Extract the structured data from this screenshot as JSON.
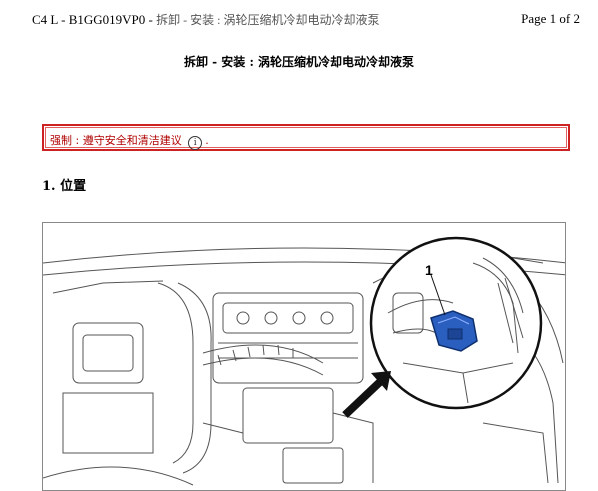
{
  "header": {
    "doc_code": "C4 L - B1GG019VP0 - ",
    "doc_title_short": "拆卸  - 安装  : 涡轮压缩机冷却电动冷却液泵",
    "page": "Page 1 of 2"
  },
  "document": {
    "title": "拆卸  - 安装  : 涡轮压缩机冷却电动冷却液泵"
  },
  "warning": {
    "label": "强制",
    "text": " : 遵守安全和清洁建议",
    "icon_glyph": "i",
    "suffix": "."
  },
  "section": {
    "number": "1.",
    "title": "位置"
  },
  "figure": {
    "callout": "1",
    "accent_color": "#1f4fa8"
  }
}
